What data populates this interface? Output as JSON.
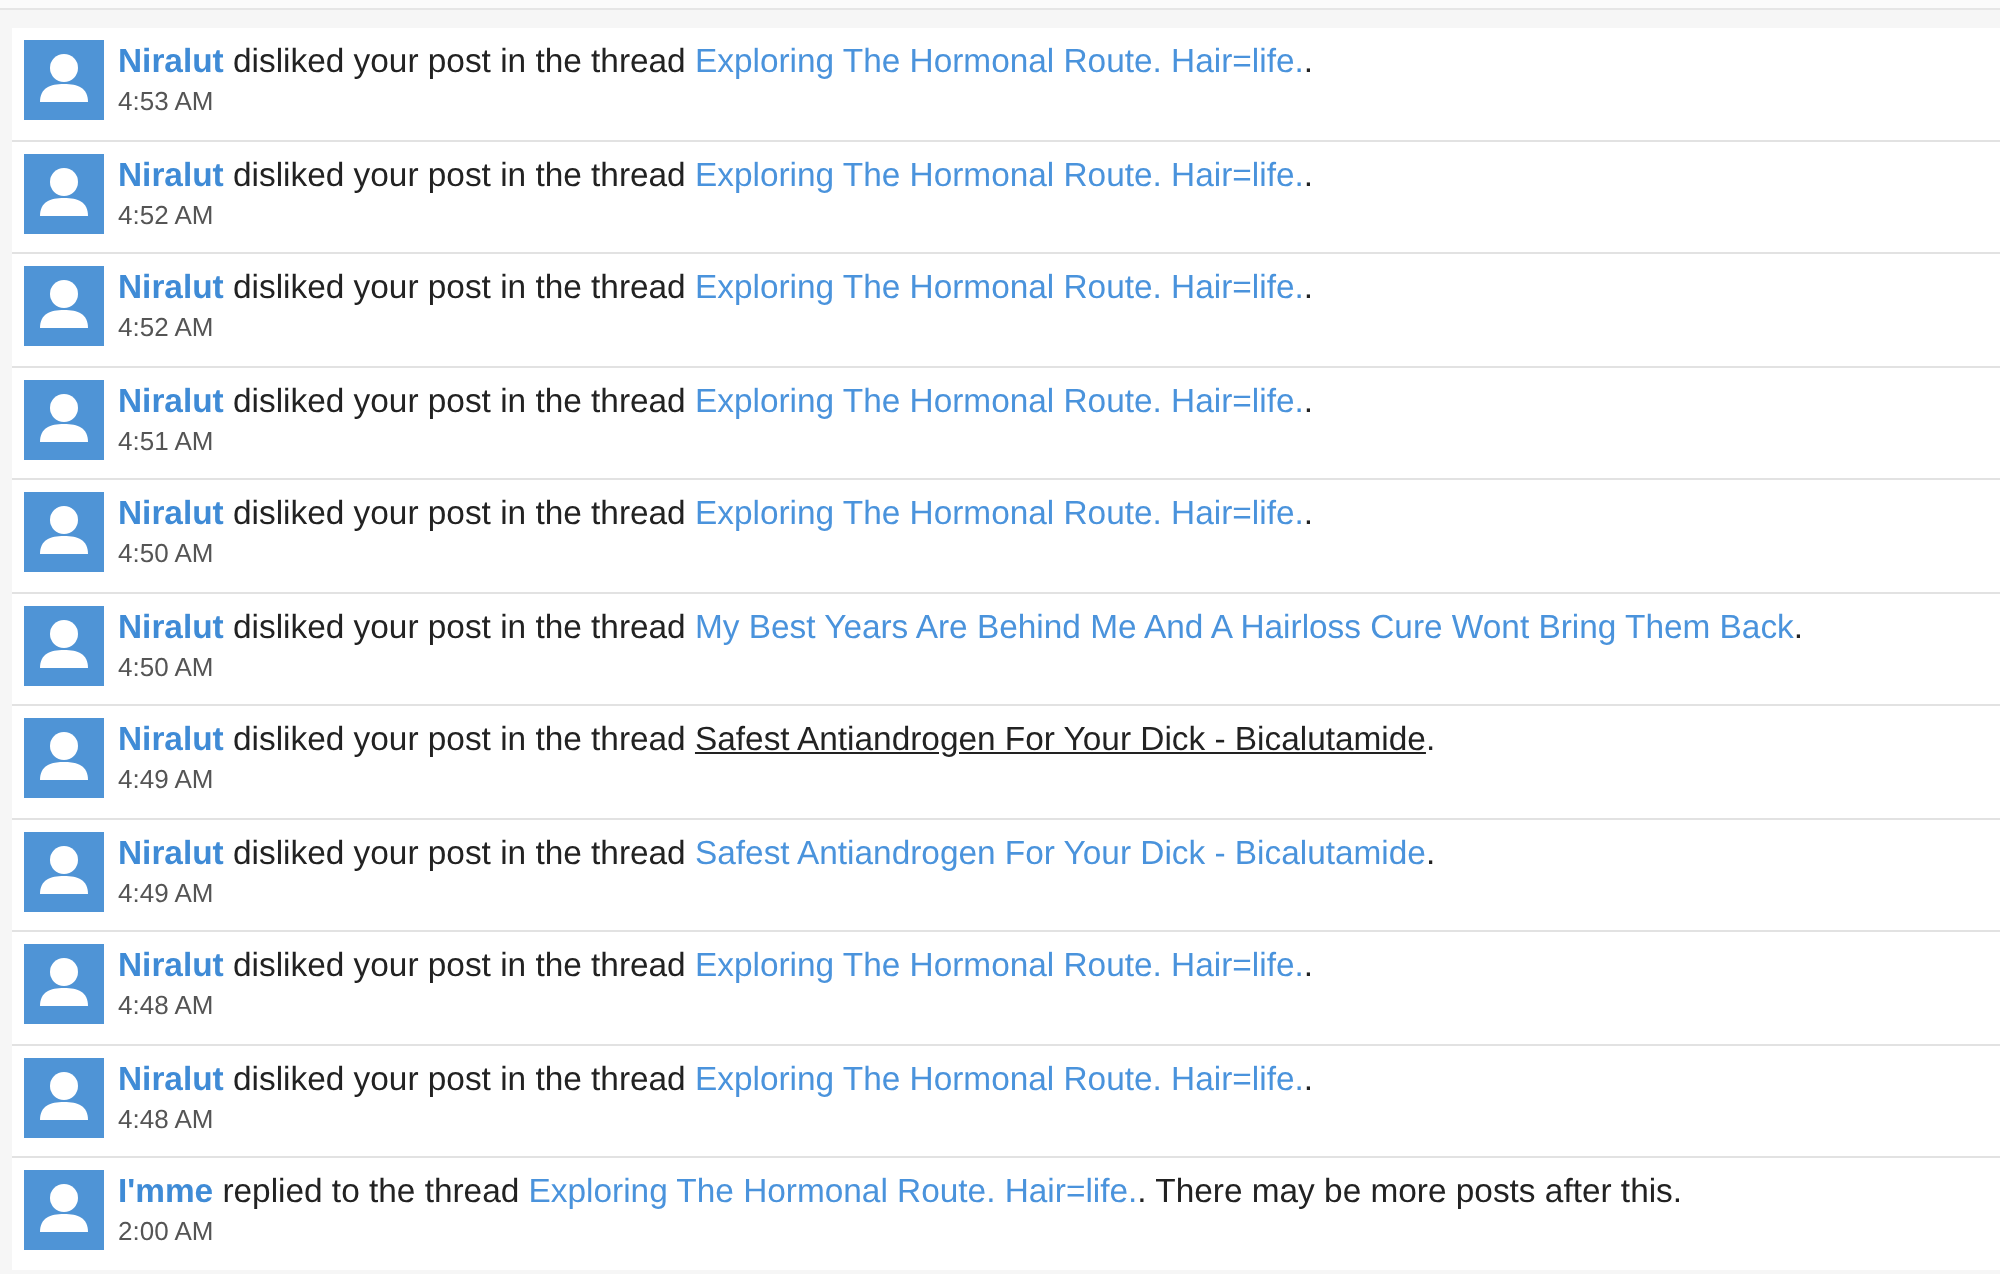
{
  "notifications": [
    {
      "user": "Niralut",
      "action": "disliked your post in the thread",
      "thread": "Exploring The Hormonal Route. Hair=life.",
      "hovered": false,
      "suffix": ".",
      "time": "4:53 AM"
    },
    {
      "user": "Niralut",
      "action": "disliked your post in the thread",
      "thread": "Exploring The Hormonal Route. Hair=life.",
      "hovered": false,
      "suffix": ".",
      "time": "4:52 AM"
    },
    {
      "user": "Niralut",
      "action": "disliked your post in the thread",
      "thread": "Exploring The Hormonal Route. Hair=life.",
      "hovered": false,
      "suffix": ".",
      "time": "4:52 AM"
    },
    {
      "user": "Niralut",
      "action": "disliked your post in the thread",
      "thread": "Exploring The Hormonal Route. Hair=life.",
      "hovered": false,
      "suffix": ".",
      "time": "4:51 AM"
    },
    {
      "user": "Niralut",
      "action": "disliked your post in the thread",
      "thread": "Exploring The Hormonal Route. Hair=life.",
      "hovered": false,
      "suffix": ".",
      "time": "4:50 AM"
    },
    {
      "user": "Niralut",
      "action": "disliked your post in the thread",
      "thread": "My Best Years Are Behind Me And A Hairloss Cure Wont Bring Them Back",
      "hovered": false,
      "suffix": ".",
      "time": "4:50 AM"
    },
    {
      "user": "Niralut",
      "action": "disliked your post in the thread",
      "thread": "Safest Antiandrogen For Your Dick - Bicalutamide",
      "hovered": true,
      "suffix": ".",
      "time": "4:49 AM"
    },
    {
      "user": "Niralut",
      "action": "disliked your post in the thread",
      "thread": "Safest Antiandrogen For Your Dick - Bicalutamide",
      "hovered": false,
      "suffix": ".",
      "time": "4:49 AM"
    },
    {
      "user": "Niralut",
      "action": "disliked your post in the thread",
      "thread": "Exploring The Hormonal Route. Hair=life.",
      "hovered": false,
      "suffix": ".",
      "time": "4:48 AM"
    },
    {
      "user": "Niralut",
      "action": "disliked your post in the thread",
      "thread": "Exploring The Hormonal Route. Hair=life.",
      "hovered": false,
      "suffix": ".",
      "time": "4:48 AM"
    },
    {
      "user": "I'mme",
      "action": "replied to the thread",
      "thread": "Exploring The Hormonal Route. Hair=life.",
      "hovered": false,
      "suffix": ". There may be more posts after this.",
      "time": "2:00 AM"
    }
  ]
}
